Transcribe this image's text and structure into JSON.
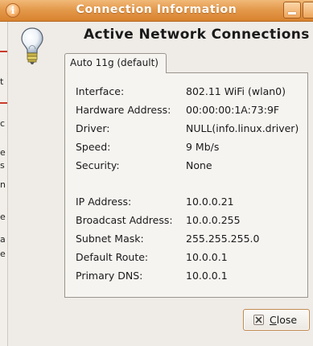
{
  "window": {
    "title": "Connection Information",
    "title_icon": "info-icon",
    "title_icon_glyph": "i"
  },
  "left_strip_fragments": [
    "t",
    "c",
    "e",
    "s",
    "n",
    "e",
    "a",
    "e"
  ],
  "header": {
    "icon": "lightbulb-icon",
    "title": "Active Network Connections"
  },
  "tabs": [
    {
      "label": "Auto 11g (default)",
      "selected": true
    }
  ],
  "details": {
    "interface": {
      "label": "Interface:",
      "value": "802.11 WiFi (wlan0)"
    },
    "hardware_address": {
      "label": "Hardware Address:",
      "value": "00:00:00:1A:73:9F"
    },
    "driver": {
      "label": "Driver:",
      "value": "NULL(info.linux.driver)"
    },
    "speed": {
      "label": "Speed:",
      "value": "9 Mb/s"
    },
    "security": {
      "label": "Security:",
      "value": "None"
    },
    "ip_address": {
      "label": "IP Address:",
      "value": "10.0.0.21"
    },
    "broadcast_address": {
      "label": "Broadcast Address:",
      "value": "10.0.0.255"
    },
    "subnet_mask": {
      "label": "Subnet Mask:",
      "value": "255.255.255.0"
    },
    "default_route": {
      "label": "Default Route:",
      "value": "10.0.0.1"
    },
    "primary_dns": {
      "label": "Primary DNS:",
      "value": "10.0.0.1"
    }
  },
  "buttons": {
    "close": {
      "mnemonic": "C",
      "rest": "lose",
      "icon": "close-x-icon"
    }
  },
  "colors": {
    "titlebar": "#e49a4c",
    "accent_border": "#c08a4e",
    "background": "#efebe7"
  }
}
